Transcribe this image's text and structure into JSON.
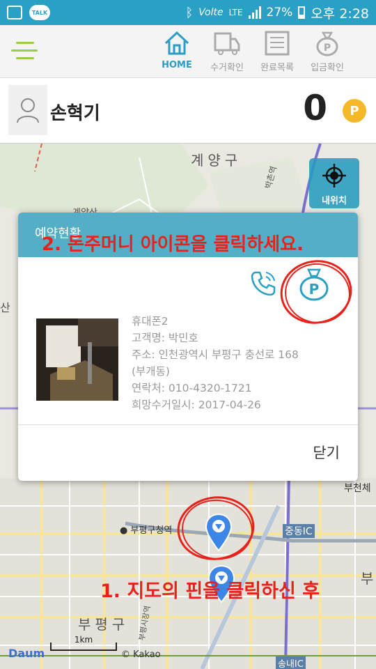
{
  "status_bar": {
    "talk": "TALK",
    "network_type": "LTE",
    "battery": "27%",
    "time": "오후 2:28",
    "icons": [
      "image-icon",
      "talk-icon",
      "bluetooth-icon",
      "volte-icon",
      "lte-icon",
      "signal-icon",
      "battery-icon"
    ]
  },
  "nav": {
    "tabs": [
      {
        "label": "HOME",
        "icon": "home-icon",
        "active": true
      },
      {
        "label": "수거확인",
        "icon": "truck-icon",
        "active": false
      },
      {
        "label": "완료목록",
        "icon": "list-icon",
        "active": false
      },
      {
        "label": "입금확인",
        "icon": "money-bag-icon",
        "active": false
      }
    ]
  },
  "profile": {
    "name": "손혁기",
    "points": "0",
    "points_badge": "P"
  },
  "map": {
    "labels": {
      "gyeyang": "계양구",
      "gyeyangsan": "계양산",
      "bakchonyeok": "박촌역",
      "san": "산",
      "bucheon": "부천체",
      "bupyeong_office": "부평구청역",
      "jungdong_ic": "중동IC",
      "bupyeong": "부평구",
      "bu": "부",
      "songnae_ic": "송내IC",
      "bupyeong_station": "부평시장역"
    },
    "my_location_button": "내위치",
    "scale": "1km",
    "copyright": "© Kakao",
    "logo": "Daum"
  },
  "annotations": {
    "step1": "1. 지도의 핀을 클릭하신 후",
    "step2": "2. 돈주머니 아이콘을 클릭하세요."
  },
  "dialog": {
    "title": "예약현황",
    "info": {
      "item": "휴대폰2",
      "customer": "고객명: 박민호",
      "address": "주소: 인천광역시 부평구 충선로 168",
      "address2": "(부개동)",
      "phone": "연락처: 010-4320-1721",
      "date": "희망수거일시: 2017-04-26"
    },
    "close_label": "닫기"
  },
  "colors": {
    "primary": "#2aa0c4",
    "accent_green": "#9ccc44",
    "dialog_header": "#53aec6",
    "point_coin": "#f5b829",
    "annotation_red": "#e8221b"
  }
}
